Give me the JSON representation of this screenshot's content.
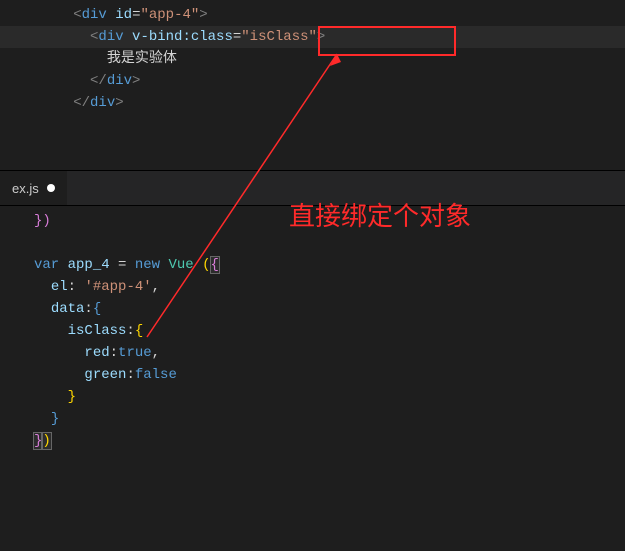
{
  "top_pane": {
    "lines": {
      "l1_open_div": "<",
      "l1_div": "div",
      "l1_sp": " ",
      "l1_id": "id",
      "l1_eq": "=",
      "l1_idval": "\"app-4\"",
      "l1_close": ">",
      "l2_open": "<",
      "l2_div": "div",
      "l2_sp": " ",
      "l2_attr": "v-bind:class",
      "l2_eq": "=",
      "l2_val": "\"isClass\"",
      "l2_close": ">",
      "l3_text": "我是实验体",
      "l4_open": "</",
      "l4_div": "div",
      "l4_close": ">",
      "l5_open": "</",
      "l5_div": "div",
      "l5_close": ">"
    }
  },
  "tab": {
    "filename": "ex.js"
  },
  "bottom_pane": {
    "close_paren": "})",
    "l_var": "var",
    "l_name": " app_4 ",
    "l_eq": "= ",
    "l_new": "new",
    "l_sp": " ",
    "l_vue": "Vue",
    "l_open_paren": " (",
    "l_open_brace": "{",
    "el_key": "el",
    "el_colon": ": ",
    "el_val": "'#app-4'",
    "el_comma": ",",
    "data_key": "data",
    "data_colon": ":",
    "data_open": "{",
    "isclass_key": "isClass",
    "isclass_colon": ":",
    "isclass_open": "{",
    "red_key": "red",
    "red_colon": ":",
    "red_val": "true",
    "red_comma": ",",
    "green_key": "green",
    "green_colon": ":",
    "green_val": "false",
    "close2": "}",
    "close1": "}",
    "close0_brace": "}",
    "close0_paren": ")"
  },
  "annotation": {
    "text": "直接绑定个对象"
  }
}
